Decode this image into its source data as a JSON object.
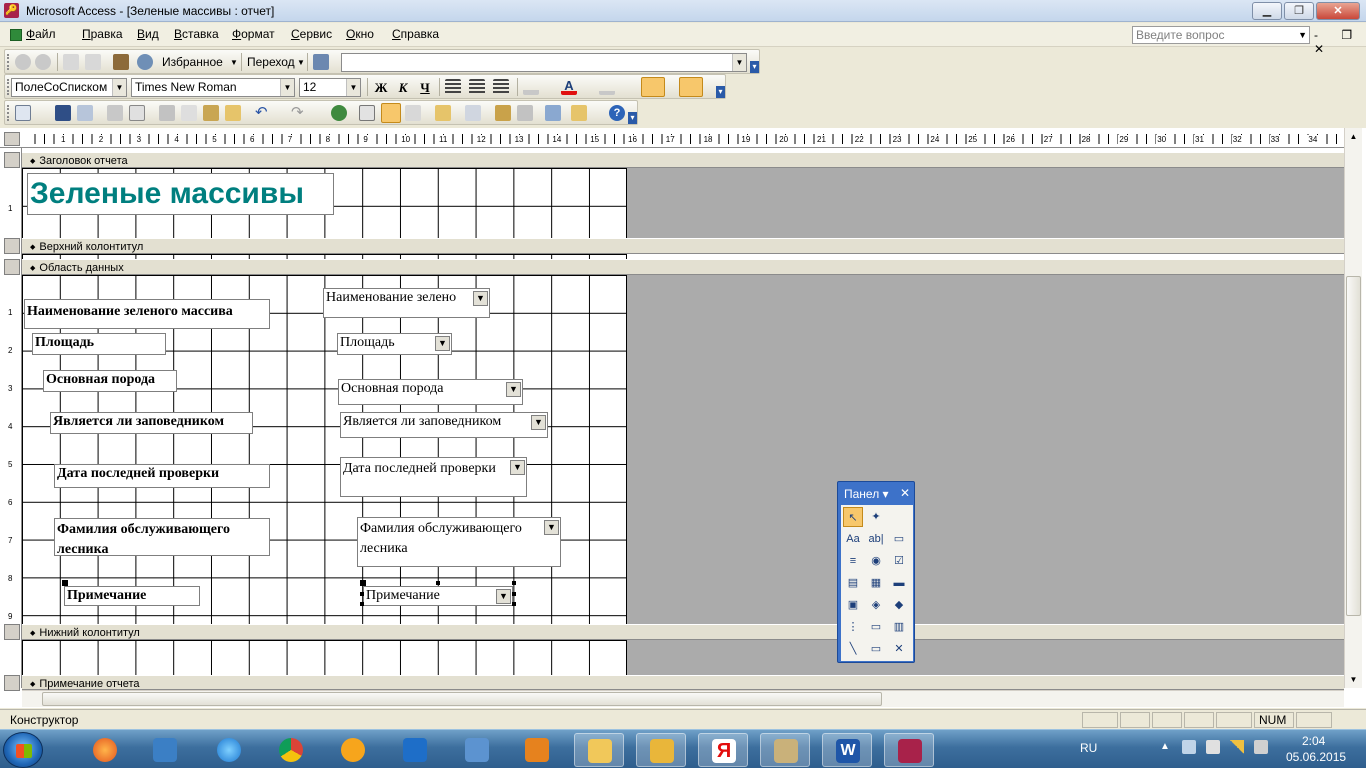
{
  "window": {
    "title": "Microsoft Access - [Зеленые массивы : отчет]",
    "min": "▁",
    "max": "❐",
    "close": "✕"
  },
  "menu": {
    "items": [
      "Файл",
      "Правка",
      "Вид",
      "Вставка",
      "Формат",
      "Сервис",
      "Окно",
      "Справка"
    ],
    "ask_placeholder": "Введите вопрос",
    "mdi_controls": "- ❐ ✕"
  },
  "toolbar_web": {
    "favorites": "Избранное",
    "goto": "Переход",
    "address": ""
  },
  "toolbar_format": {
    "object_combo": "ПолеСоСписком",
    "font": "Times New Roman",
    "size": "12",
    "bold": "Ж",
    "italic": "К",
    "underline": "Ч"
  },
  "ruler": {
    "marks": [
      "1",
      "2",
      "3",
      "4",
      "5",
      "6",
      "7",
      "8",
      "9",
      "10",
      "11",
      "12",
      "13",
      "14",
      "15",
      "16",
      "17",
      "18",
      "19",
      "20",
      "21",
      "22",
      "23",
      "24",
      "25",
      "26",
      "27",
      "28",
      "29",
      "30",
      "31",
      "32",
      "33",
      "34"
    ],
    "vmarks_header": [
      "1"
    ],
    "vmarks_data": [
      "1",
      "2",
      "3",
      "4",
      "5",
      "6",
      "7",
      "8",
      "9"
    ]
  },
  "bands": {
    "report_header": "Заголовок отчета",
    "page_header": "Верхний колонтитул",
    "detail": "Область данных",
    "page_footer": "Нижний колонтитул",
    "report_footer": "Примечание отчета"
  },
  "report_title": "Зеленые массивы",
  "labels": {
    "name": "Наименование зеленого массива",
    "area": "Площадь",
    "species": "Основная порода",
    "reserve": "Является ли заповедником",
    "check_date": "Дата последней проверки",
    "forester": "Фамилия обслуживающего лесника",
    "notes": "Примечание"
  },
  "fields": {
    "name": "Наименование зелено",
    "area": "Площадь",
    "species": "Основная порода",
    "reserve": "Является ли заповедником",
    "check_date": "Дата последней проверки",
    "forester": "Фамилия обслуживающего лесника",
    "notes": "Примечание"
  },
  "toolbox": {
    "title": "Панел ▾",
    "close": "✕"
  },
  "status": {
    "mode": "Конструктор",
    "num": "NUM"
  },
  "taskbar": {
    "lang": "RU",
    "time": "2:04",
    "date": "05.06.2015"
  }
}
